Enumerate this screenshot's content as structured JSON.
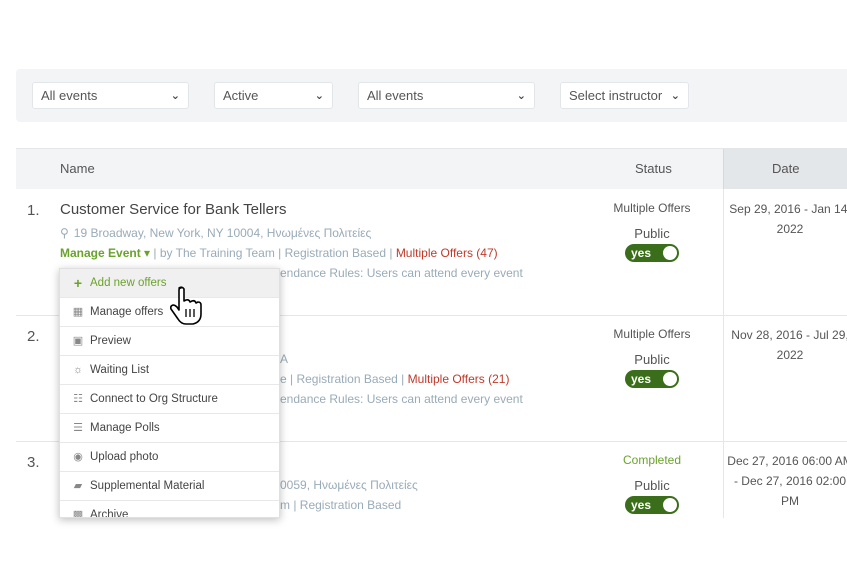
{
  "filters": [
    {
      "name": "events-filter-1",
      "value": "All events"
    },
    {
      "name": "status-filter",
      "value": "Active"
    },
    {
      "name": "events-filter-2",
      "value": "All events"
    },
    {
      "name": "instructor-filter",
      "value": "Select instructor"
    }
  ],
  "table": {
    "headers": {
      "name": "Name",
      "status": "Status",
      "date": "Date"
    }
  },
  "rows": [
    {
      "num": "1.",
      "title": "Customer Service for Bank Tellers",
      "address": "19 Broadway, New York, NY 10004, Ηνωμένες Πολιτείες",
      "manage": "Manage Event",
      "by": "| by The Training Team | Registration Based |",
      "offers": "Multiple Offers (47)",
      "rules": "endance Rules: Users can attend every event",
      "status": "Multiple Offers",
      "public": "Public",
      "toggle": "yes",
      "date": "Sep 29, 2016 - Jan 14, 2022"
    },
    {
      "num": "2.",
      "address": "A",
      "meta": "e | Registration Based |",
      "offers": "Multiple Offers (21)",
      "rules": "endance Rules: Users can attend every event",
      "status": "Multiple Offers",
      "public": "Public",
      "toggle": "yes",
      "date": "Nov 28, 2016 - Jul 29, 2022"
    },
    {
      "num": "3.",
      "address": "0059, Ηνωμένες Πολιτείες",
      "meta": "m | Registration Based",
      "status": "Completed",
      "public": "Public",
      "toggle": "yes",
      "date": "Dec 27, 2016 06:00 AM - Dec 27, 2016 02:00 PM"
    }
  ],
  "dropdown": [
    {
      "label": "Add new offers",
      "icon": "plus-icon"
    },
    {
      "label": "Manage offers",
      "icon": "calendar-icon"
    },
    {
      "label": "Preview",
      "icon": "preview-icon"
    },
    {
      "label": "Waiting List",
      "icon": "users-icon"
    },
    {
      "label": "Connect to Org Structure",
      "icon": "org-structure-icon"
    },
    {
      "label": "Manage Polls",
      "icon": "chart-icon"
    },
    {
      "label": "Upload photo",
      "icon": "camera-icon"
    },
    {
      "label": "Supplemental Material",
      "icon": "folder-icon"
    },
    {
      "label": "Archive",
      "icon": "archive-icon"
    }
  ],
  "colors": {
    "accent_green": "#6aa22b",
    "toggle_green": "#3b6e1a",
    "red": "#c0392b",
    "muted_blue": "#99abb8"
  }
}
